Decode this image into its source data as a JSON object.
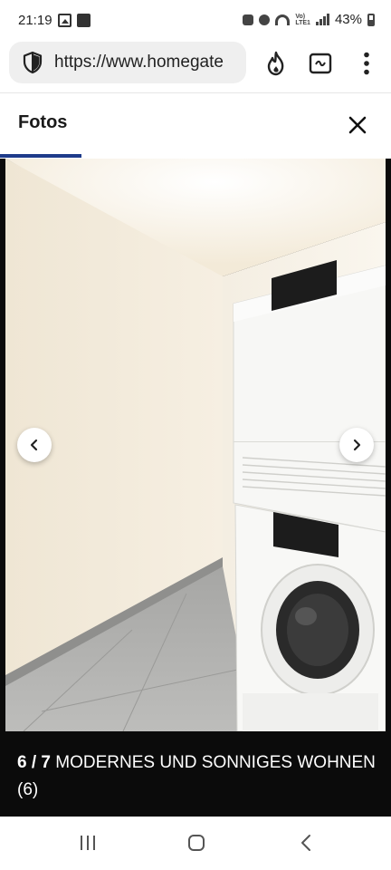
{
  "status_bar": {
    "time": "21:19",
    "volte_line1": "Vo)",
    "volte_line2": "LTE1",
    "battery": "43%"
  },
  "browser": {
    "url": "https://www.homegate",
    "icons": [
      "shield-icon",
      "flame-icon",
      "tab-switcher-icon",
      "more-vert-icon"
    ]
  },
  "header": {
    "tab_label": "Fotos",
    "accent_color": "#1e3b8a"
  },
  "gallery": {
    "counter": "6 / 7",
    "caption": "MODERNES UND SONNIGES WOHNEN (6)",
    "background": "#0b0b0b"
  },
  "nav_bar": {
    "icons": [
      "recent-apps-icon",
      "home-icon",
      "back-icon"
    ]
  }
}
